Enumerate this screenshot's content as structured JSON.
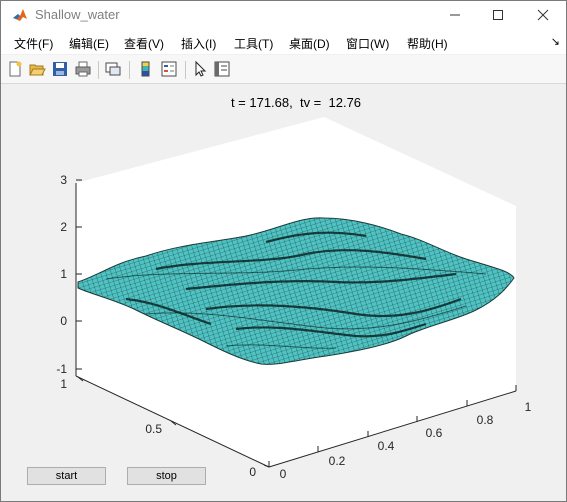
{
  "window": {
    "title": "Shallow_water"
  },
  "menu": [
    "文件(F)",
    "编辑(E)",
    "查看(V)",
    "插入(I)",
    "工具(T)",
    "桌面(D)",
    "窗口(W)",
    "帮助(H)"
  ],
  "toolbar": [
    "new-file-icon",
    "open-folder-icon",
    "save-icon",
    "print-icon",
    "link-plot-icon",
    "colorbar-icon",
    "legend-icon",
    "pointer-icon",
    "property-editor-icon"
  ],
  "plot": {
    "title": "t = 171.68,  tv =  12.76",
    "z_ticks": [
      "3",
      "2",
      "1",
      "0",
      "-1"
    ],
    "y_ticks": [
      "1",
      "0.5",
      "0"
    ],
    "x_ticks": [
      "0",
      "0.2",
      "0.4",
      "0.6",
      "0.8",
      "1"
    ],
    "surface_color": "#4fc3c3"
  },
  "chart_data": {
    "type": "surface",
    "title": "t = 171.68,  tv =  12.76",
    "xlim": [
      0,
      1
    ],
    "ylim": [
      0,
      1
    ],
    "zlim": [
      -1,
      3
    ],
    "x_ticks": [
      0,
      0.2,
      0.4,
      0.6,
      0.8,
      1
    ],
    "y_ticks": [
      0,
      0.5,
      1
    ],
    "z_ticks": [
      -1,
      0,
      1,
      2,
      3
    ],
    "grid": false
  },
  "buttons": {
    "start": "start",
    "stop": "stop"
  }
}
